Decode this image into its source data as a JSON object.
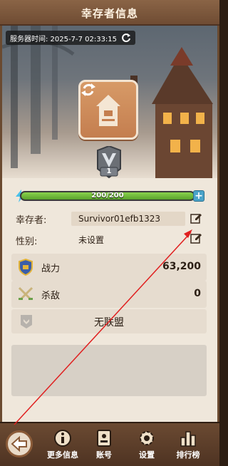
{
  "header": {
    "title": "幸存者信息"
  },
  "server": {
    "time_text": "服务器时间: 2025-7-7 02:33:15"
  },
  "profile": {
    "rank_level": "1",
    "hp_text": "200/200",
    "hp_fraction": 1.0
  },
  "fields": {
    "survivor_label": "幸存者:",
    "survivor_value": "Survivor01efb1323",
    "gender_label": "性别:",
    "gender_value": "未设置"
  },
  "stats": {
    "power_label": "战力",
    "power_value": "63,200",
    "kills_label": "杀敌",
    "kills_value": "0"
  },
  "alliance": {
    "label": "无联盟"
  },
  "nav": {
    "more_info": "更多信息",
    "account": "账号",
    "settings": "设置",
    "leaderboard": "排行榜"
  },
  "colors": {
    "accent": "#c47e4f",
    "hp_green": "#5aa22c",
    "annotation_red": "#e02020"
  }
}
